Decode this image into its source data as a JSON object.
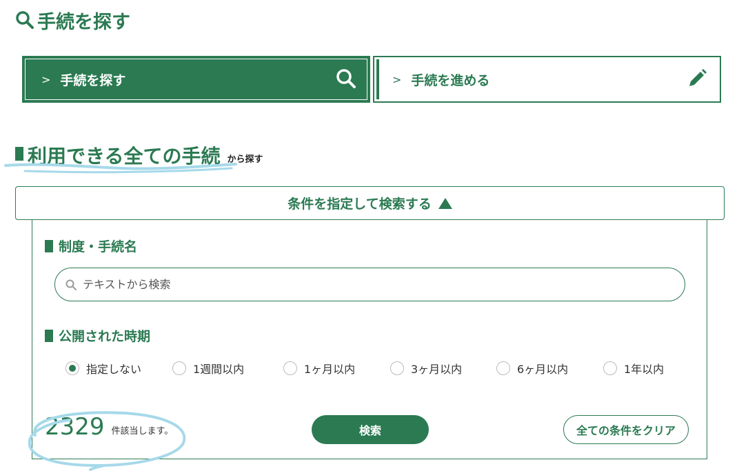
{
  "page": {
    "title": "手続を探す"
  },
  "tabs": [
    {
      "label": "手続を探す",
      "active": true,
      "icon": "search-icon"
    },
    {
      "label": "手続を進める",
      "active": false,
      "icon": "pencil-icon"
    }
  ],
  "section": {
    "title": "利用できる全ての手続",
    "suffix": "から探す"
  },
  "filter": {
    "toggle_label": "条件を指定して検索する",
    "name_heading": "制度・手続名",
    "search_placeholder": "テキストから検索",
    "period_heading": "公開された時期",
    "period_options": [
      {
        "label": "指定しない",
        "checked": true
      },
      {
        "label": "1週間以内",
        "checked": false
      },
      {
        "label": "1ヶ月以内",
        "checked": false
      },
      {
        "label": "3ヶ月以内",
        "checked": false
      },
      {
        "label": "6ヶ月以内",
        "checked": false
      },
      {
        "label": "1年以内",
        "checked": false
      }
    ],
    "result_count": "2329",
    "result_suffix": "件該当します。",
    "search_button": "検索",
    "clear_button": "全ての条件をクリア"
  },
  "colors": {
    "brand": "#2b7a52",
    "annotation": "#a6d9ea"
  }
}
